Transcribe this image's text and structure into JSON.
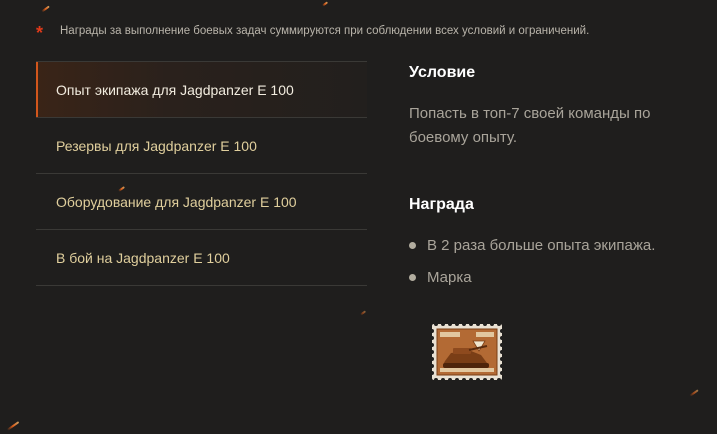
{
  "notice": {
    "asterisk": "*",
    "text": "Награды за выполнение боевых задач суммируются при соблюдении всех условий и ограничений."
  },
  "missions": [
    {
      "label": "Опыт экипажа для Jagdpanzer E 100",
      "active": true
    },
    {
      "label": "Резервы для Jagdpanzer E 100",
      "active": false
    },
    {
      "label": "Оборудование для Jagdpanzer E 100",
      "active": false
    },
    {
      "label": "В бой на Jagdpanzer E 100",
      "active": false
    }
  ],
  "condition": {
    "title": "Условие",
    "text": "Попасть в топ-7 своей команды по боевому опыту."
  },
  "reward": {
    "title": "Награда",
    "items": [
      "В 2 раза больше опыта экипажа.",
      "Марка"
    ]
  },
  "stamp": {
    "icon": "stamp-icon"
  },
  "colors": {
    "background": "#1f1e1d",
    "accent": "#d2561c",
    "list_text": "#e0cf9d",
    "asterisk": "#e03a1a"
  }
}
